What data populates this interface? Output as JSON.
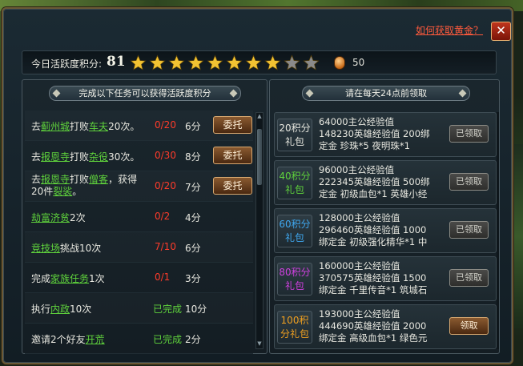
{
  "header": {
    "help_link": "如何获取黄金？",
    "close_symbol": "✕"
  },
  "topbar": {
    "label": "今日活跃度积分:",
    "score": "81",
    "stars_filled": 8,
    "stars_total": 10,
    "coin_value": "50"
  },
  "left_panel": {
    "title": "完成以下任务可以获得活跃度积分",
    "tasks": [
      {
        "parts": [
          "去",
          "蓟州城",
          "打败",
          "车夫",
          "20次。"
        ],
        "progress": "0/20",
        "points": "6分",
        "button": "委托",
        "done": false
      },
      {
        "parts": [
          "去",
          "报恩寺",
          "打败",
          "杂役",
          "30次。"
        ],
        "progress": "0/30",
        "points": "8分",
        "button": "委托",
        "done": false
      },
      {
        "parts": [
          "去",
          "报恩寺",
          "打败",
          "僧客",
          "，获得20件",
          "裂裟",
          "。"
        ],
        "progress": "0/20",
        "points": "7分",
        "button": "委托",
        "done": false
      },
      {
        "parts": [
          "",
          "劫富济贫",
          "2次"
        ],
        "progress": "0/2",
        "points": "4分",
        "done": false
      },
      {
        "parts": [
          "",
          "竞技场",
          "挑战10次"
        ],
        "progress": "7/10",
        "points": "6分",
        "done": false
      },
      {
        "parts": [
          "完成",
          "家族任务",
          "1次"
        ],
        "progress": "0/1",
        "points": "3分",
        "done": false
      },
      {
        "parts": [
          "执行",
          "内政",
          "10次"
        ],
        "progress": "已完成",
        "points": "10分",
        "done": true
      },
      {
        "parts": [
          "邀请2个好友",
          "开荒",
          ""
        ],
        "progress": "已完成",
        "points": "2分",
        "done": true
      }
    ]
  },
  "right_panel": {
    "title": "请在每天24点前领取",
    "rewards": [
      {
        "tier_lines": [
          "20积分",
          "礼包"
        ],
        "tier_color": "#e8e8e0",
        "lines": [
          "64000主公经验值",
          "148230英雄经验值 200绑",
          "定金 珍珠*5 夜明珠*1"
        ],
        "button": "已领取",
        "claimed": true
      },
      {
        "tier_lines": [
          "40积分",
          "礼包"
        ],
        "tier_color": "#5fd23c",
        "lines": [
          "96000主公经验值",
          "222345英雄经验值 500绑",
          "定金 初级血包*1 英雄小经"
        ],
        "button": "已领取",
        "claimed": true
      },
      {
        "tier_lines": [
          "60积分",
          "礼包"
        ],
        "tier_color": "#3fa8f0",
        "lines": [
          "128000主公经验值",
          "296460英雄经验值 1000",
          "绑定金 初级强化精华*1 中"
        ],
        "button": "已领取",
        "claimed": true
      },
      {
        "tier_lines": [
          "80积分",
          "礼包"
        ],
        "tier_color": "#d040e0",
        "lines": [
          "160000主公经验值",
          "370575英雄经验值 1500",
          "绑定金 千里传音*1 筑城石"
        ],
        "button": "已领取",
        "claimed": true
      },
      {
        "tier_lines": [
          "100积",
          "分礼包"
        ],
        "tier_color": "#f0a020",
        "lines": [
          "193000主公经验值",
          "444690英雄经验值 2000",
          "绑定金 高级血包*1 绿色元"
        ],
        "button": "领取",
        "claimed": false
      }
    ]
  },
  "colors": {
    "star_filled": "#f2c232",
    "star_empty": "#8a8a8a",
    "highlight_green": "#5fd23c",
    "progress_red": "#ff3b2a",
    "help_red": "#ff5a3c"
  }
}
